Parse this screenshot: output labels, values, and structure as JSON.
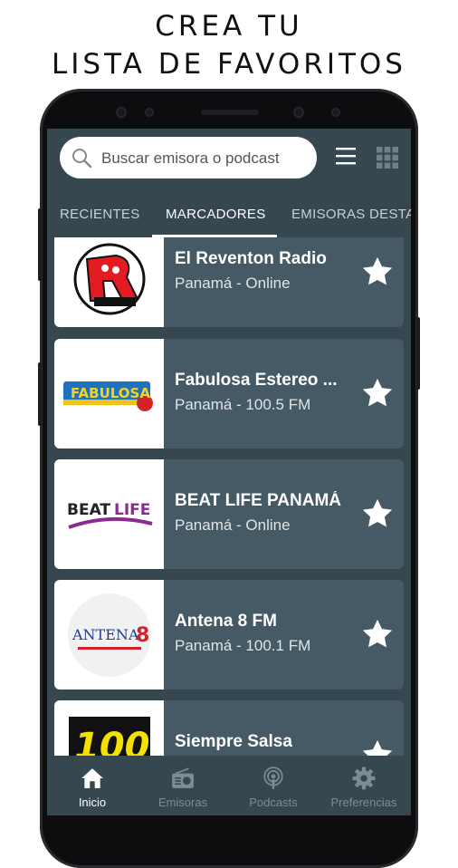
{
  "headline": {
    "line1": "CREA TU",
    "line2": "LISTA DE FAVORITOS"
  },
  "search": {
    "placeholder": "Buscar emisora o podcast"
  },
  "header": {
    "menu_icon": "hamburger-menu-icon",
    "grid_icon": "grid-view-icon"
  },
  "tabs": [
    {
      "label": "RECIENTES",
      "active": false
    },
    {
      "label": "MARCADORES",
      "active": true
    },
    {
      "label": "EMISORAS DESTA",
      "active": false
    }
  ],
  "stations": [
    {
      "name": "El Reventon Radio",
      "subtitle": "Panamá - Online",
      "logo": "reventon-logo",
      "favorite": true
    },
    {
      "name": "Fabulosa Estereo ...",
      "subtitle": "Panamá - 100.5 FM",
      "logo": "fabulosa-logo",
      "logo_text": "FABULOSA",
      "favorite": true
    },
    {
      "name": "BEAT LIFE PANAMÁ",
      "subtitle": "Panamá - Online",
      "logo": "beatlife-logo",
      "logo_text_1": "BEAT",
      "logo_text_2": "LIFE",
      "favorite": true
    },
    {
      "name": "Antena 8 FM",
      "subtitle": "Panamá - 100.1 FM",
      "logo": "antena8-logo",
      "logo_text_1": "ANTENA",
      "logo_text_2": "8",
      "favorite": true
    },
    {
      "name": "Siempre Salsa",
      "subtitle": "",
      "logo": "salsa-logo",
      "logo_text": "100",
      "favorite": true
    }
  ],
  "bottom_nav": [
    {
      "label": "Inicio",
      "icon": "home-icon",
      "active": true
    },
    {
      "label": "Emisoras",
      "icon": "radio-icon",
      "active": false
    },
    {
      "label": "Podcasts",
      "icon": "podcast-icon",
      "active": false
    },
    {
      "label": "Preferencias",
      "icon": "gear-icon",
      "active": false
    }
  ],
  "colors": {
    "app_bg": "#37474f",
    "card_bg": "#455a64",
    "accent": "#ffffff",
    "nav_inactive": "#7d8c93"
  }
}
